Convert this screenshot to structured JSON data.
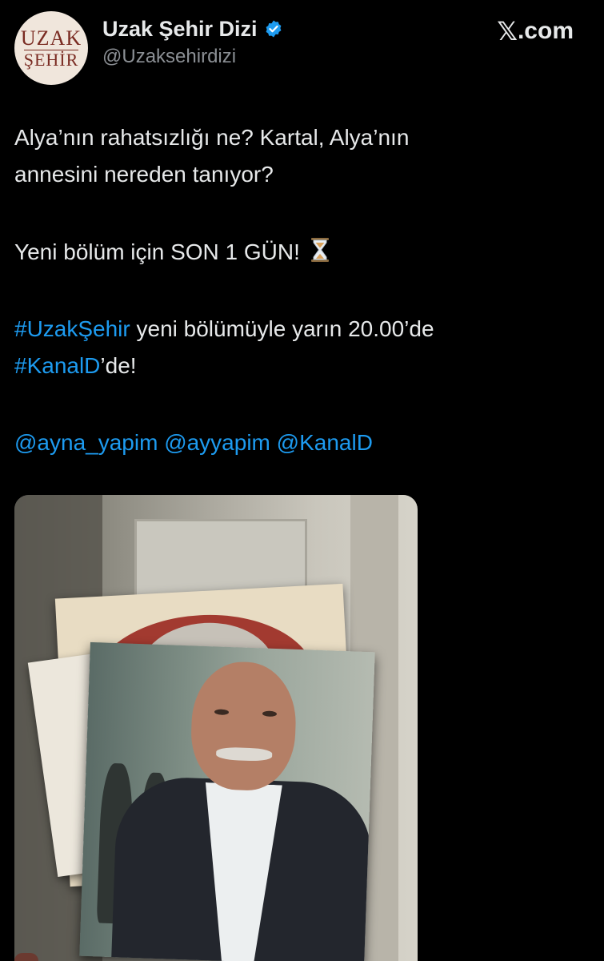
{
  "header": {
    "avatar_text_line1": "UZAK",
    "avatar_text_line2": "ŞEHİR",
    "display_name": "Uzak Şehir Dizi",
    "handle": "@Uzaksehirdizi",
    "brand_x": "𝕏",
    "brand_text": ".com"
  },
  "tweet": {
    "line1": "Alya’nın rahatsızlığı ne? Kartal, Alya’nın",
    "line2": "annesini nereden tanıyor?",
    "line3": "Yeni bölüm için SON 1 GÜN!",
    "hashtag1": "#UzakŞehir",
    "line4_rest": " yeni bölümüyle yarın 20.00’de",
    "hashtag2": "#KanalD",
    "line5_rest": "’de!",
    "mention1": "@ayna_yapim",
    "mention2": "@ayyapim",
    "mention3": "@KanalD"
  },
  "colors": {
    "background": "#000000",
    "text": "#e7e9ea",
    "secondary": "#8b8f94",
    "link": "#1d9bf0",
    "verified": "#1d9bf0"
  },
  "icons": {
    "verified": "verified-badge-icon",
    "hourglass": "hourglass-icon"
  }
}
